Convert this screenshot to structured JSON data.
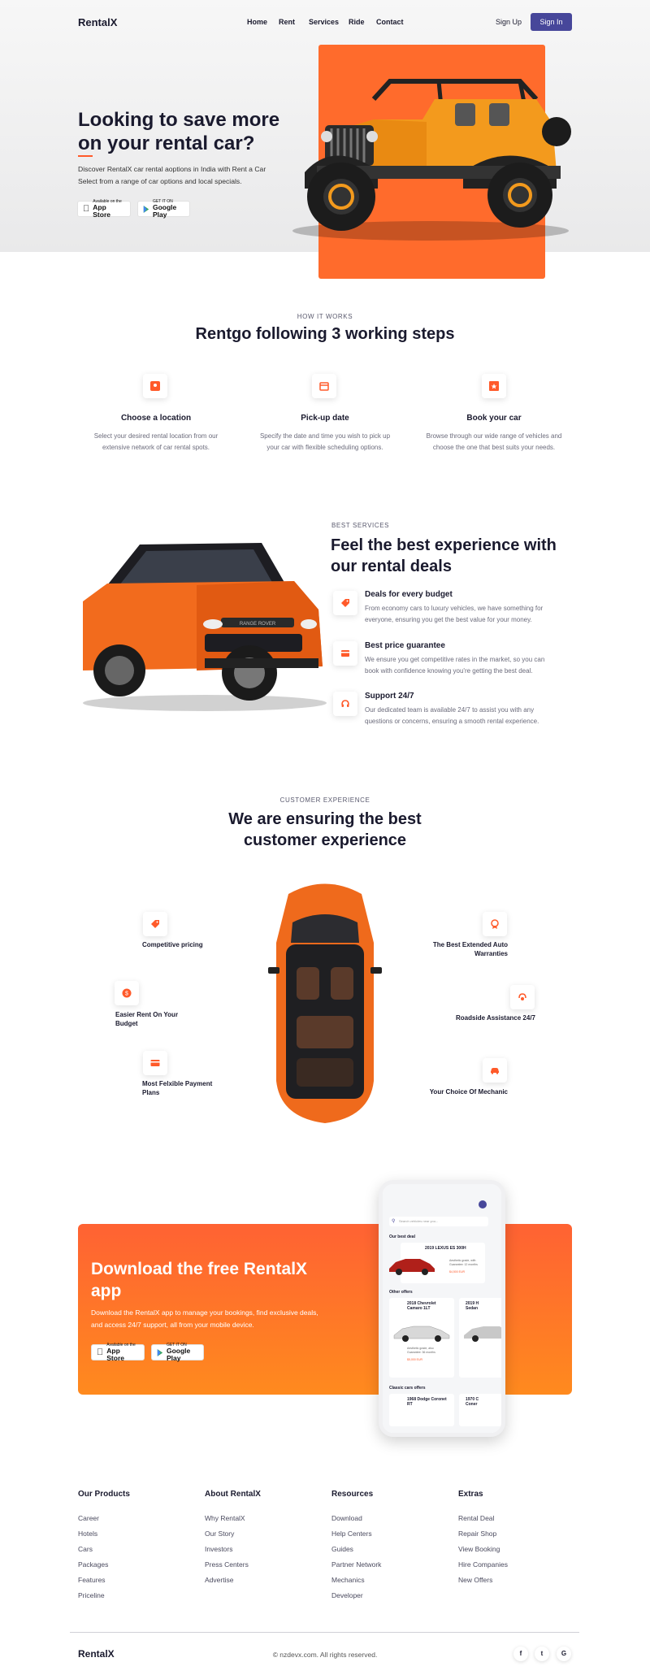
{
  "brand": {
    "name": "RentalX"
  },
  "nav": {
    "links": [
      "Home",
      "Rent",
      "Services",
      "Ride",
      "Contact"
    ],
    "signup": "Sign Up",
    "signin": "Sign In"
  },
  "hero": {
    "title_line1": "Looking to save more",
    "title_line2": "on your rental car?",
    "desc_line1": "Discover RentalX car rental aoptions in India with Rent a Car",
    "desc_line2": "Select from a range of car options and local specials.",
    "appstore_small": "Available on the",
    "appstore_big": "App Store",
    "play_small": "GET IT ON",
    "play_big": "Google Play"
  },
  "how": {
    "eyebrow": "HOW IT WORKS",
    "title": "Rentgo following 3 working steps",
    "steps": [
      {
        "icon": "location-pin-icon",
        "title": "Choose a location",
        "desc1": "Select your desired rental location from our",
        "desc2": "extensive network of car rental spots."
      },
      {
        "icon": "calendar-icon",
        "title": "Pick-up date",
        "desc1": "Specify the date and time you wish to pick up",
        "desc2": "your car with flexible scheduling options."
      },
      {
        "icon": "bookmark-star-icon",
        "title": "Book your car",
        "desc1": "Browse through our wide range of vehicles and",
        "desc2": "choose the one that best suits your needs."
      }
    ]
  },
  "services": {
    "eyebrow": "BEST SERVICES",
    "title_line1": "Feel the best experience with",
    "title_line2": "our rental deals",
    "car_badge": "RANGE ROVER",
    "items": [
      {
        "icon": "price-tag-icon",
        "title": "Deals for every budget",
        "desc1": "From economy cars to luxury vehicles, we have something for",
        "desc2": "everyone, ensuring you get the best value for your money."
      },
      {
        "icon": "wallet-icon",
        "title": "Best price guarantee",
        "desc1": "We ensure you get competitive rates in the market, so you can",
        "desc2": "book with confidence knowing you're getting the best deal."
      },
      {
        "icon": "headset-icon",
        "title": "Support 24/7",
        "desc1": "Our dedicated team is available 24/7 to assist you with any",
        "desc2": "questions or concerns, ensuring a smooth rental experience."
      }
    ]
  },
  "experience": {
    "eyebrow": "CUSTOMER EXPERIENCE",
    "title_line1": "We are ensuring the best",
    "title_line2": "customer experience",
    "left": [
      {
        "icon": "price-tag-icon",
        "l1": "Competitive pricing",
        "l2": ""
      },
      {
        "icon": "coin-icon",
        "l1": "Easier Rent On Your",
        "l2": "Budget"
      },
      {
        "icon": "card-icon",
        "l1": "Most Felxible Payment",
        "l2": "Plans"
      }
    ],
    "right": [
      {
        "icon": "award-icon",
        "l1": "The Best Extended Auto",
        "l2": "Warranties"
      },
      {
        "icon": "support-icon",
        "l1": "Roadside Assistance 24/7",
        "l2": ""
      },
      {
        "icon": "car-icon",
        "l1": "Your Choice Of Mechanic",
        "l2": ""
      }
    ]
  },
  "app": {
    "title_line1": "Download the free RentalX",
    "title_line2": "app",
    "desc_line1": "Download the RentalX app to manage your bookings, find exclusive deals,",
    "desc_line2": "and access 24/7 support, all from your mobile device.",
    "phone": {
      "search_placeholder": "Search vehicles near you...",
      "best_deal": "Our best deal",
      "deal_car": "2019 LEXUS ES 300H",
      "deal_note1": "Aesthetic grade, with",
      "deal_note2": "Guarantee: 12 months",
      "deal_price": "$4,500 EUR",
      "other_offers": "Other offers",
      "offer1_l1": "2018 Chevrolet",
      "offer1_l2": "Camaro 1LT",
      "offer1_note1": "Aesthetic grade, also",
      "offer1_note2": "Guarantee: 36 months",
      "offer1_price": "$5,000 EUR",
      "offer2_l1": "2019 H",
      "offer2_l2": "Sedan",
      "classic": "Classic cars offers",
      "classic1_l1": "1968 Dodge Coronet",
      "classic1_l2": "RT",
      "classic2_l1": "1970 C",
      "classic2_l2": "Coner"
    }
  },
  "footer": {
    "columns": [
      {
        "head": "Our Products",
        "links": [
          "Career",
          "Hotels",
          "Cars",
          "Packages",
          "Features",
          "Priceline"
        ]
      },
      {
        "head": "About RentalX",
        "links": [
          "Why RentalX",
          "Our Story",
          "Investors",
          "Press Centers",
          "Advertise"
        ]
      },
      {
        "head": "Resources",
        "links": [
          "Download",
          "Help Centers",
          "Guides",
          "Partner Network",
          "Mechanics",
          "Developer"
        ]
      },
      {
        "head": "Extras",
        "links": [
          "Rental Deal",
          "Repair Shop",
          "View Booking",
          "Hire Companies",
          "New Offers"
        ]
      }
    ],
    "copyright": "© nzdevx.com. All rights reserved.",
    "social": [
      "f",
      "t",
      "G"
    ]
  },
  "colors": {
    "accent": "#ff5a2a",
    "primary_button": "#47479a",
    "text_dark": "#1a1a2e"
  }
}
